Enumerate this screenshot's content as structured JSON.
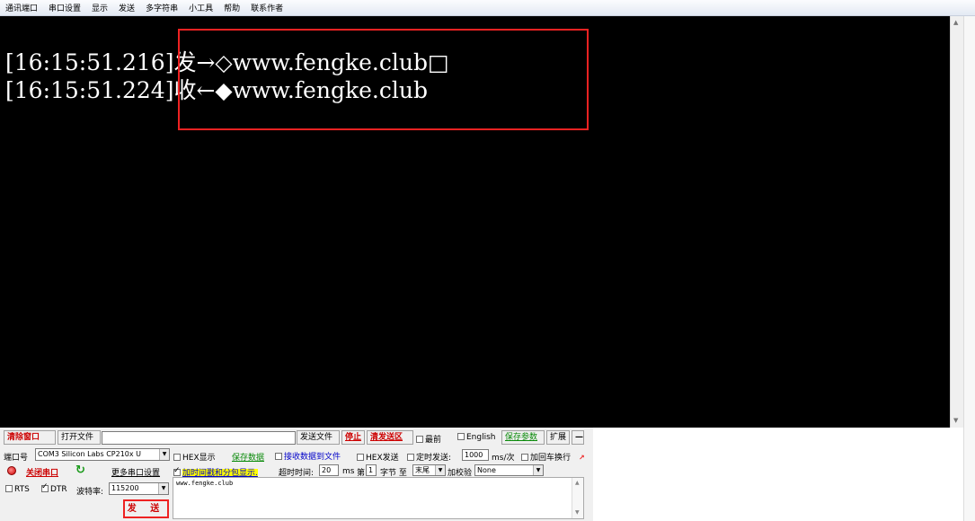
{
  "menu": [
    "通讯端口",
    "串口设置",
    "显示",
    "发送",
    "多字符串",
    "小工具",
    "帮助",
    "联系作者"
  ],
  "terminal": {
    "lines": [
      "[16:15:51.216]发→◇www.fengke.club□",
      "[16:15:51.224]收←◆www.fengke.club"
    ],
    "text_color": "#ffffff",
    "background": "#000000",
    "highlight_color": "#ee2222"
  },
  "toolbar": {
    "clear_window": "清除窗口",
    "open_file": "打开文件",
    "file_path": "",
    "send_file": "发送文件",
    "stop": "停止",
    "clear_send": "清发送区",
    "top_most": "最前",
    "english": "English",
    "save_params": "保存参数",
    "expand": "扩展",
    "collapse": "—"
  },
  "port": {
    "port_label": "端口号",
    "port_value": "COM3 Silicon Labs CP210x U",
    "close_port": "关闭串口",
    "more_settings": "更多串口设置",
    "rts": "RTS",
    "dtr": "DTR",
    "baud_label": "波特率:",
    "baud_value": "115200",
    "send_button": "发 送"
  },
  "options": {
    "hex_display": "HEX显示",
    "save_data": "保存数据",
    "recv_to_file": "接收数据到文件",
    "hex_send": "HEX发送",
    "timed_send": "定时发送:",
    "interval": "1000",
    "interval_unit": "ms/次",
    "add_crlf": "加回车换行",
    "timestamp": "加时间戳和分包显示.",
    "timeout_label": "超时时间:",
    "timeout": "20",
    "timeout_unit": "ms",
    "byte_no_label": "第",
    "byte_no": "1",
    "byte_label": "字节 至",
    "end_value": "末尾",
    "checksum_label": "加校验",
    "checksum_value": "None"
  },
  "send_area": {
    "text": "www.fengke.club"
  }
}
